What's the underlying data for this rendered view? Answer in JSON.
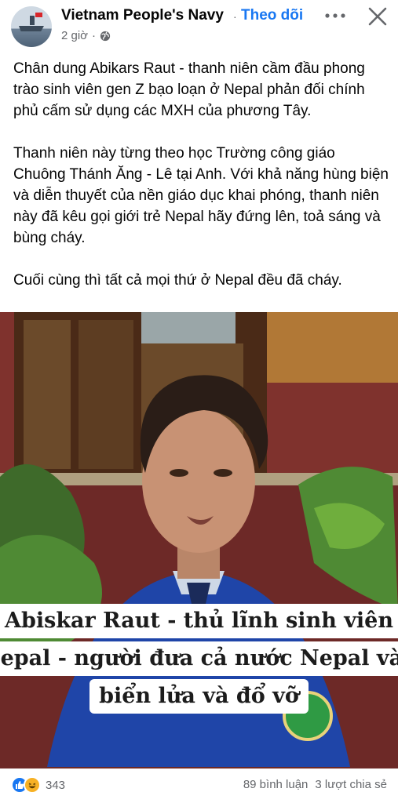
{
  "header": {
    "page_name": "Vietnam People's Navy",
    "separator": "·",
    "follow_label": "Theo dõi",
    "time": "2 giờ",
    "meta_separator": "·",
    "audience_icon": "globe-icon",
    "more_icon": "more-dots-icon",
    "close_icon": "close-icon"
  },
  "post": {
    "paragraphs": [
      "Chân dung Abikars Raut - thanh niên cầm đầu phong trào sinh viên gen Z bạo loạn ở Nepal phản đối chính phủ cấm sử dụng các MXH của phương Tây.",
      "Thanh niên này  từng theo học Trường công giáo Chuông Thánh Ăng - Lê tại Anh. Với khả năng hùng biện và diễn thuyết của nền giáo dục khai phóng, thanh niên này đã  kêu gọi giới trẻ Nepal hãy đứng lên, toả sáng và bùng cháy.",
      "Cuối cùng thì tất cả mọi thứ ở Nepal đều đã cháy."
    ]
  },
  "photo": {
    "caption_lines": [
      "Abiskar Raut - thủ lĩnh sinh viên",
      "Nepal - người đưa cả nước Nepal vào",
      "biển lửa và đổ vỡ"
    ]
  },
  "footer": {
    "reaction_icons": [
      "like-icon",
      "haha-icon"
    ],
    "reaction_count": "343",
    "comments": "89 bình luận",
    "shares": "3 lượt chia sẻ"
  },
  "colors": {
    "accent": "#1877f2",
    "secondary_text": "#65676b",
    "like": "#1877f2",
    "haha": "#f7b125"
  }
}
